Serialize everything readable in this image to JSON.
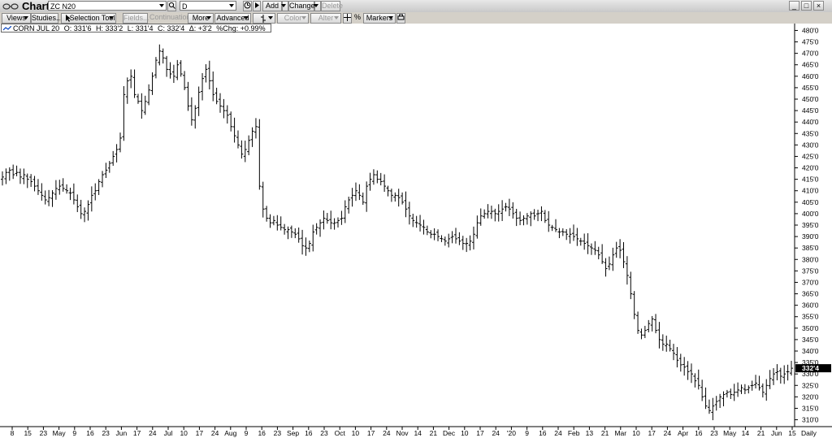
{
  "window": {
    "title": "Chart",
    "symbol_value": "ZC N20",
    "period_value": "D",
    "add_label": "Add",
    "change_label": "Change",
    "delete_label": "Delete"
  },
  "toolbar": {
    "views_label": "Views",
    "studies_label": "Studies...",
    "selection_tool_label": "Selection Tool",
    "fields_label": "Fields...",
    "continuation_label": "Continuation",
    "more_label": "More",
    "advanced_label": "Advanced",
    "color_label": "Color",
    "alter_label": "Alter",
    "percent_label": "%",
    "markers_label": "Markers"
  },
  "legend": {
    "symbol": "CORN JUL 20",
    "open": "O: 331'6",
    "high": "H: 333'2",
    "low": "L: 331'4",
    "close": "C: 332'4",
    "delta": "Δ: +3'2",
    "pct_change": "%Chg: +0.99%"
  },
  "colors": {
    "bar": "#000000",
    "grid": "#c8c8c8",
    "last_price_bg": "#000000",
    "last_price_fg": "#ffffff"
  },
  "chart_data": {
    "type": "ohlc",
    "ylim": [
      307,
      483
    ],
    "y_ticks": [
      310,
      315,
      320,
      325,
      330,
      335,
      340,
      345,
      350,
      355,
      360,
      365,
      370,
      375,
      380,
      385,
      390,
      395,
      400,
      405,
      410,
      415,
      420,
      425,
      430,
      435,
      440,
      445,
      450,
      455,
      460,
      465,
      470,
      475,
      480
    ],
    "y_tick_labels": [
      "310'0",
      "315'0",
      "320'0",
      "325'0",
      "330'0",
      "335'0",
      "340'0",
      "345'0",
      "350'0",
      "355'0",
      "360'0",
      "365'0",
      "370'0",
      "375'0",
      "380'0",
      "385'0",
      "390'0",
      "395'0",
      "400'0",
      "405'0",
      "410'0",
      "415'0",
      "420'0",
      "425'0",
      "430'0",
      "435'0",
      "440'0",
      "445'0",
      "450'0",
      "455'0",
      "460'0",
      "465'0",
      "470'0",
      "475'0",
      "480'0"
    ],
    "last_price": 332.5,
    "last_price_label": "332'4",
    "x_tick_labels": [
      "8",
      "15",
      "23",
      "May",
      "9",
      "16",
      "23",
      "Jun",
      "17",
      "24",
      "Jul",
      "10",
      "17",
      "24",
      "Aug",
      "9",
      "16",
      "23",
      "Sep",
      "16",
      "23",
      "Oct",
      "10",
      "17",
      "24",
      "Nov",
      "14",
      "21",
      "Dec",
      "10",
      "17",
      "24",
      "'20",
      "9",
      "16",
      "24",
      "Feb",
      "13",
      "21",
      "Mar",
      "10",
      "17",
      "24",
      "Apr",
      "16",
      "23",
      "May",
      "14",
      "21",
      "Jun",
      "15"
    ],
    "x_axis_unit": "Daily",
    "closes": [
      416,
      418,
      419,
      417,
      418,
      416,
      417,
      415,
      414,
      412,
      410,
      408,
      406,
      407,
      409,
      411,
      412,
      411,
      410,
      409,
      406,
      403,
      400,
      401,
      404,
      408,
      410,
      414,
      417,
      419,
      422,
      425,
      428,
      433,
      452,
      458,
      460,
      452,
      449,
      445,
      449,
      454,
      460,
      467,
      471,
      468,
      463,
      461,
      460,
      465,
      461,
      455,
      447,
      441,
      446,
      453,
      459,
      463,
      458,
      452,
      449,
      447,
      445,
      443,
      438,
      434,
      430,
      426,
      428,
      432,
      436,
      438,
      412,
      402,
      398,
      396,
      397,
      395,
      394,
      393,
      393,
      392,
      391,
      389,
      386,
      385,
      387,
      392,
      394,
      396,
      398,
      397,
      396,
      396,
      397,
      398,
      403,
      406,
      408,
      410,
      408,
      405,
      412,
      415,
      417,
      415,
      414,
      412,
      410,
      408,
      408,
      407,
      405,
      402,
      399,
      397,
      396,
      395,
      394,
      392,
      391,
      391,
      390,
      389,
      388,
      389,
      390,
      389,
      388,
      387,
      387,
      388,
      391,
      396,
      399,
      400,
      401,
      401,
      400,
      401,
      402,
      403,
      402,
      400,
      398,
      397,
      398,
      399,
      400,
      399,
      400,
      401,
      397,
      395,
      394,
      393,
      392,
      392,
      391,
      391,
      390,
      389,
      388,
      387,
      386,
      385,
      384,
      382,
      379,
      376,
      378,
      382,
      385,
      384,
      379,
      373,
      365,
      356,
      349,
      347,
      349,
      352,
      354,
      349,
      345,
      343,
      343,
      341,
      339,
      336,
      334,
      333,
      331,
      330,
      327,
      325,
      320,
      316,
      314,
      316,
      318,
      320,
      321,
      322,
      321,
      322,
      323,
      324,
      323,
      324,
      325,
      326,
      324,
      322,
      325,
      328,
      330,
      331,
      329,
      330,
      331,
      332.5
    ]
  }
}
